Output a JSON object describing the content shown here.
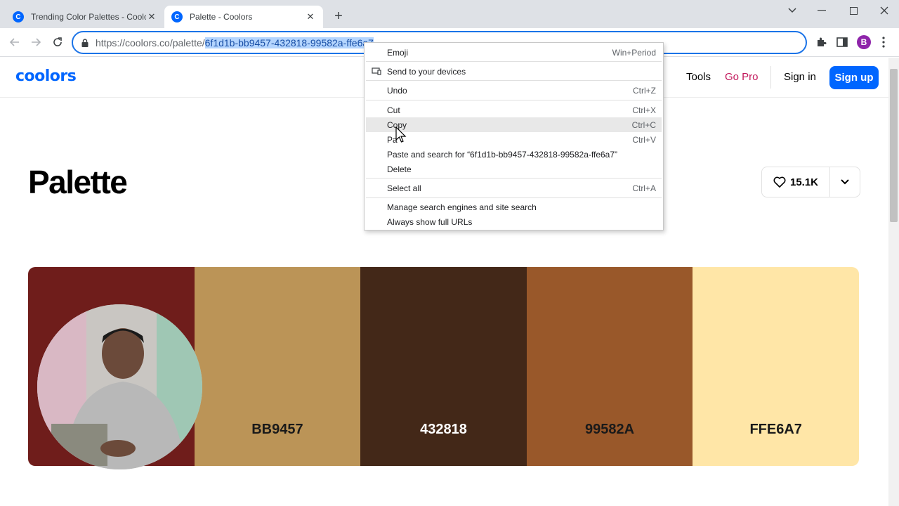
{
  "browser": {
    "tabs": [
      {
        "title": "Trending Color Palettes - Coolor",
        "close": "✕"
      },
      {
        "title": "Palette - Coolors",
        "close": "✕"
      }
    ],
    "new_tab": "+",
    "url_base": "https://coolors.co/palette/",
    "url_selected": "6f1d1b-bb9457-432818-99582a-ffe6a7",
    "profile_initial": "B"
  },
  "site": {
    "logo": "coolors",
    "nav": {
      "tools": "Tools",
      "go_pro": "Go Pro",
      "sign_in": "Sign in",
      "sign_up": "Sign up"
    },
    "title": "Palette",
    "likes": "15.1K"
  },
  "palette": {
    "swatches": [
      {
        "color": "#6f1d1b",
        "label": "",
        "text_color": "#ffffff"
      },
      {
        "color": "#bb9457",
        "label": "BB9457",
        "text_color": "#1a1a1a"
      },
      {
        "color": "#432818",
        "label": "432818",
        "text_color": "#ffffff"
      },
      {
        "color": "#99582a",
        "label": "99582A",
        "text_color": "#1a1a1a"
      },
      {
        "color": "#ffe6a7",
        "label": "FFE6A7",
        "text_color": "#1a1a1a"
      }
    ]
  },
  "context_menu": {
    "emoji": {
      "label": "Emoji",
      "shortcut": "Win+Period"
    },
    "send": {
      "label": "Send to your devices"
    },
    "undo": {
      "label": "Undo",
      "shortcut": "Ctrl+Z"
    },
    "cut": {
      "label": "Cut",
      "shortcut": "Ctrl+X"
    },
    "copy": {
      "label": "Copy",
      "shortcut": "Ctrl+C"
    },
    "paste": {
      "label": "Pa",
      "shortcut": "Ctrl+V"
    },
    "paste_search": {
      "label": "Paste and search for “6f1d1b-bb9457-432818-99582a-ffe6a7”"
    },
    "delete": {
      "label": "Delete"
    },
    "select_all": {
      "label": "Select all",
      "shortcut": "Ctrl+A"
    },
    "manage": {
      "label": "Manage search engines and site search"
    },
    "full_urls": {
      "label": "Always show full URLs"
    }
  },
  "colors": {
    "accent": "#0066ff",
    "go_pro": "#c2185b",
    "omnibox_focus": "#1a73e8"
  }
}
